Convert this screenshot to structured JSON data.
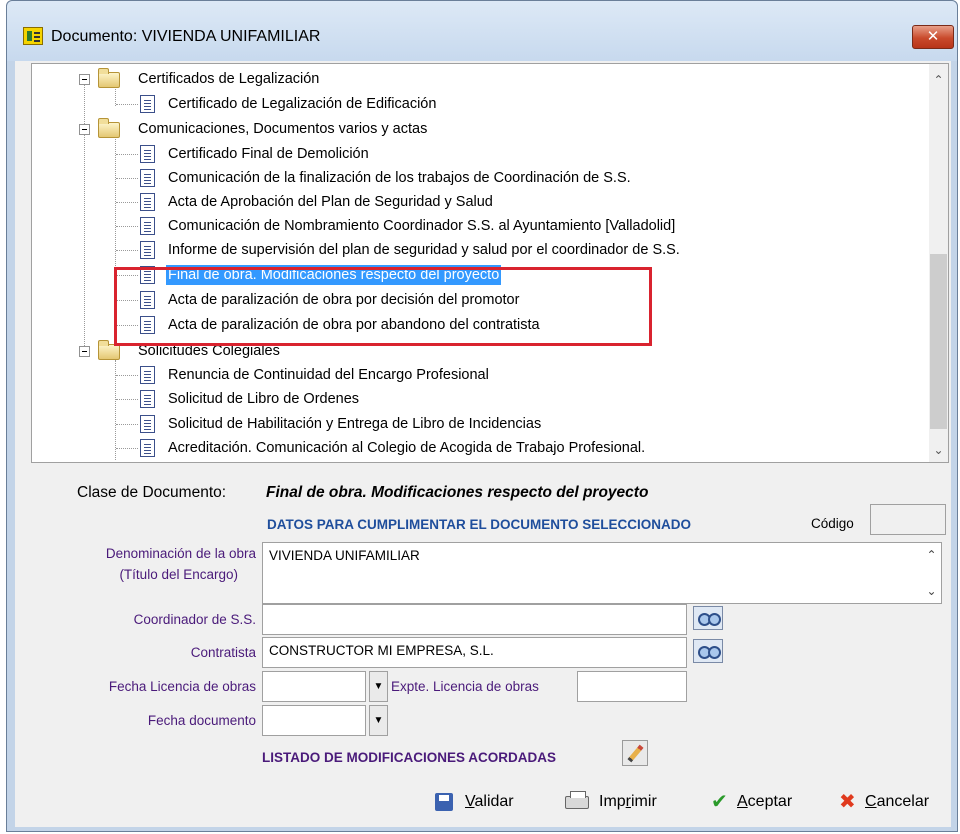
{
  "window": {
    "title": "Documento: VIVIENDA UNIFAMILIAR",
    "close_glyph": "✕"
  },
  "tree": {
    "groups": [
      {
        "label": "Certificados de Legalización",
        "items": [
          "Certificado de Legalización de Edificación"
        ]
      },
      {
        "label": "Comunicaciones, Documentos varios y actas",
        "items": [
          "Certificado Final de Demolición",
          "Comunicación de la finalización de los trabajos de Coordinación de S.S.",
          "Acta de Aprobación del Plan de Seguridad y Salud",
          "Comunicación de Nombramiento Coordinador S.S. al Ayuntamiento [Valladolid]",
          "Informe de supervisión del plan de seguridad y salud por el coordinador de S.S.",
          "Final de obra. Modificaciones respecto del proyecto",
          "Acta de paralización de obra por decisión del promotor",
          "Acta de paralización de obra por abandono del contratista"
        ]
      },
      {
        "label": "Solicitudes Colegiales",
        "items": [
          "Renuncia de Continuidad del Encargo Profesional",
          "Solicitud de Libro de Ordenes",
          "Solicitud de Habilitación y Entrega de Libro de Incidencias",
          "Acreditación. Comunicación al Colegio de Acogida de Trabajo Profesional."
        ]
      }
    ],
    "selected": "Final de obra. Modificaciones respecto del proyecto"
  },
  "form": {
    "clase_label": "Clase de Documento:",
    "clase_value": "Final de obra. Modificaciones respecto del proyecto",
    "section_title": "DATOS PARA CUMPLIMENTAR EL DOCUMENTO SELECCIONADO",
    "codigo_label": "Código",
    "codigo_value": "",
    "denominacion_label_1": "Denominación de la obra",
    "denominacion_label_2": "(Título del Encargo)",
    "denominacion_value": "VIVIENDA UNIFAMILIAR",
    "coordinador_label": "Coordinador de S.S.",
    "coordinador_value": "",
    "contratista_label": "Contratista",
    "contratista_value": "CONSTRUCTOR MI EMPRESA, S.L.",
    "fecha_licencia_label": "Fecha Licencia de obras",
    "fecha_licencia_value": "",
    "expte_label": "Expte. Licencia de obras",
    "expte_value": "",
    "fecha_documento_label": "Fecha documento",
    "fecha_documento_value": "",
    "listado_title": "LISTADO DE MODIFICACIONES ACORDADAS"
  },
  "buttons": {
    "validar": {
      "accel": "V",
      "rest": "alidar"
    },
    "imprimir": {
      "pre": "Imp",
      "accel": "r",
      "rest": "imir"
    },
    "aceptar": {
      "accel": "A",
      "rest": "ceptar"
    },
    "cancelar": {
      "accel": "C",
      "rest": "ancelar"
    }
  },
  "glyphs": {
    "scroll_up": "⌃",
    "scroll_down": "⌄",
    "dropdown": "▼",
    "check": "✔",
    "cross": "✖"
  },
  "colors": {
    "selection": "#3399ff",
    "highlight_box": "#d9232f",
    "section_title": "#1f4e9c",
    "field_label": "#4a1a7a"
  }
}
